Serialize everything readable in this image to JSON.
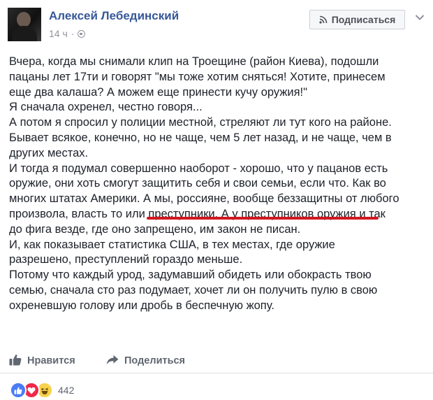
{
  "header": {
    "author": "Алексей Лебединский",
    "time": "14 ч",
    "dot": "·",
    "subscribe_label": "Подписаться"
  },
  "post": {
    "lines": [
      "Вчера, когда мы снимали клип на Троещине (район Киева), подошли",
      "пацаны лет 17ти и говорят \"мы тоже хотим сняться! Хотите, принесем",
      "еще два калаша? А можем еще принести кучу оружия!\"",
      "Я сначала охренел, честно говоря...",
      "А потом я спросил у полиции местной, стреляют ли тут кого на районе.",
      "Бывает всякое, конечно, но не чаще, чем 5 лет назад, и не чаще, чем в",
      "других местах.",
      "И тогда я подумал совершенно наоборот - хорошо, что у пацанов есть",
      "оружие, они хоть смогут защитить себя и свои семьи, если что. Как во",
      "многих штатах Америки. А мы, россияне, вообще беззащитны от любого",
      "произвола, власть то или преступники. А у преступников оружия и так",
      "до фига везде, где оно запрещено, им закон не писан.",
      "И, как показывает статистика США, в тех местах, где оружие",
      "разрешено, преступлений гораздо меньше.",
      "Потому что каждый урод, задумавший обидеть или обокрасть твою",
      "семью, сначала сто раз подумает, хочет ли он получить пулю в свою",
      "охреневшую голову или дробь в беспечную жопу."
    ],
    "underline_color": "#d01822"
  },
  "actions": {
    "like_label": "Нравится",
    "share_label": "Поделиться"
  },
  "reactions": {
    "icons": [
      "like-icon",
      "love-icon",
      "haha-icon"
    ],
    "count": "442"
  },
  "colors": {
    "link": "#365899",
    "meta": "#90949c",
    "text": "#1d2129"
  }
}
